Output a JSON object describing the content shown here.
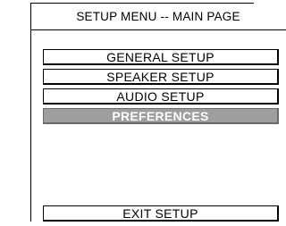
{
  "header": {
    "title": "SETUP MENU -- MAIN PAGE"
  },
  "menu": {
    "items": [
      {
        "label": "GENERAL SETUP",
        "selected": false
      },
      {
        "label": "SPEAKER SETUP",
        "selected": false
      },
      {
        "label": "AUDIO SETUP",
        "selected": false
      },
      {
        "label": "PREFERENCES",
        "selected": true
      }
    ],
    "exit_label": "EXIT SETUP"
  },
  "colors": {
    "border": "#000000",
    "background": "#ffffff",
    "selected_background": "#9e9e9e",
    "selected_text": "#ffffff"
  }
}
